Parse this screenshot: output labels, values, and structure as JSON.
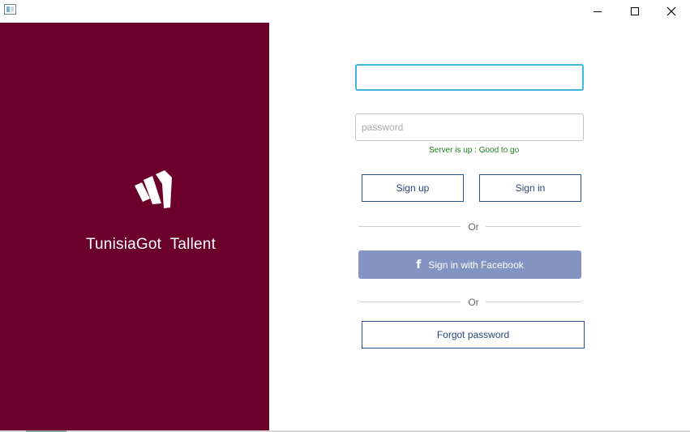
{
  "window": {
    "controls": {
      "minimize": "minimize",
      "maximize": "maximize",
      "close": "close"
    }
  },
  "brand": {
    "name": "TunisiaGot  Tallent",
    "background_color": "#6b002a",
    "logo_icon": "brand-stripes-logo"
  },
  "login": {
    "username": {
      "value": "",
      "placeholder": ""
    },
    "password": {
      "value": "",
      "placeholder": "password"
    },
    "status": "Server is up : Good to go",
    "status_color": "#1a7f1a",
    "signup_label": "Sign up",
    "signin_label": "Sign in",
    "or_label": "Or",
    "facebook_label": "Sign in with Facebook",
    "facebook_icon": "f",
    "facebook_color": "#8394c3",
    "forgot_label": "Forgot password"
  }
}
